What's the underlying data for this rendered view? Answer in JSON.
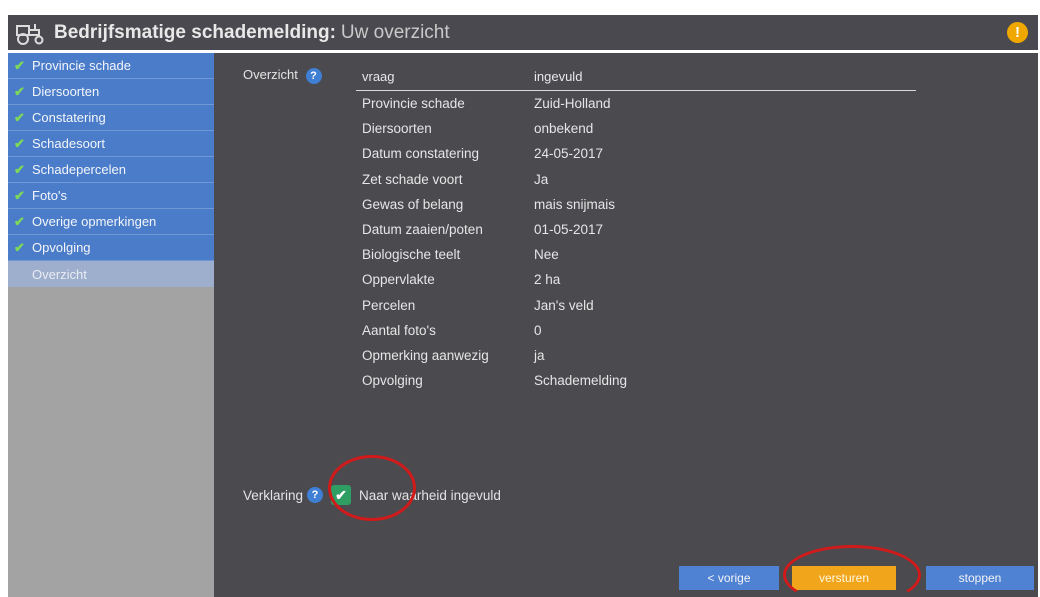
{
  "header": {
    "title_bold": "Bedrijfsmatige schademelding:",
    "title_light": "Uw overzicht",
    "warning_symbol": "!"
  },
  "sidebar": {
    "items": [
      {
        "label": "Provincie schade",
        "done": true
      },
      {
        "label": "Diersoorten",
        "done": true
      },
      {
        "label": "Constatering",
        "done": true
      },
      {
        "label": "Schadesoort",
        "done": true
      },
      {
        "label": "Schadepercelen",
        "done": true
      },
      {
        "label": "Foto's",
        "done": true
      },
      {
        "label": "Overige opmerkingen",
        "done": true
      },
      {
        "label": "Opvolging",
        "done": true
      },
      {
        "label": "Overzicht",
        "done": false,
        "active": true
      }
    ]
  },
  "overview": {
    "label": "Overzicht",
    "help": "?",
    "head": {
      "question": "vraag",
      "answer": "ingevuld"
    },
    "rows": [
      {
        "q": "Provincie schade",
        "a": "Zuid-Holland"
      },
      {
        "q": "Diersoorten",
        "a": "onbekend"
      },
      {
        "q": "Datum constatering",
        "a": "24-05-2017"
      },
      {
        "q": "Zet schade voort",
        "a": "Ja"
      },
      {
        "q": "Gewas of belang",
        "a": "mais snijmais"
      },
      {
        "q": "Datum zaaien/poten",
        "a": "01-05-2017"
      },
      {
        "q": "Biologische teelt",
        "a": "Nee"
      },
      {
        "q": "Oppervlakte",
        "a": "2 ha"
      },
      {
        "q": "Percelen",
        "a": "Jan's veld"
      },
      {
        "q": "Aantal foto's",
        "a": "0"
      },
      {
        "q": "Opmerking aanwezig",
        "a": "ja"
      },
      {
        "q": "Opvolging",
        "a": "Schademelding"
      }
    ]
  },
  "verklaring": {
    "label": "Verklaring",
    "help": "?",
    "checked": true,
    "text": "Naar waarheid ingevuld"
  },
  "buttons": {
    "prev": "< vorige",
    "send": "versturen",
    "stop": "stoppen"
  },
  "colors": {
    "header_bg": "#49494f",
    "sidebar_item": "#4a7cc9",
    "main_bg": "#4a4a4f",
    "accent_orange": "#f0a51a",
    "accent_blue": "#4f82d3",
    "annotation_red": "#d11a1a"
  }
}
